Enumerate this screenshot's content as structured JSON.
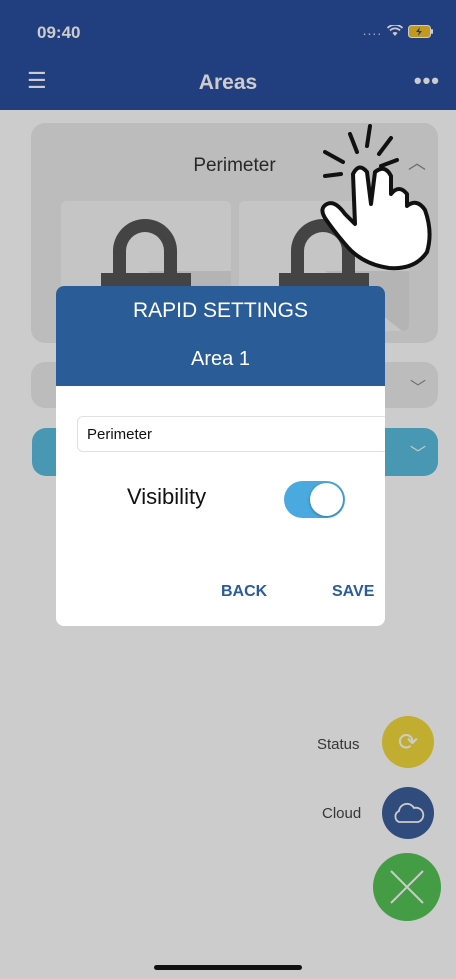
{
  "status_bar": {
    "time": "09:40",
    "signal": "....",
    "wifi_icon": "wifi-icon",
    "battery_icon": "battery-charging-icon"
  },
  "header": {
    "title": "Areas",
    "menu_icon": "hamburger-menu-icon",
    "more_icon": "more-dots-icon"
  },
  "area_card": {
    "title": "Perimeter",
    "chevron_icon": "chevron-up-icon"
  },
  "colors": {
    "header": "#2A4F9F",
    "dialog_header": "#2A5C97",
    "toggle_on": "#4aa9de",
    "status_fab": "#f2da3c",
    "cloud_fab": "#3d5f9c",
    "close_fab": "#55c455"
  },
  "dialog": {
    "title": "RAPID SETTINGS",
    "subtitle": "Area 1",
    "name_value": "Perimeter",
    "visibility_label": "Visibility",
    "visibility_on": true,
    "back_label": "BACK",
    "save_label": "SAVE"
  },
  "fabs": {
    "status_label": "Status",
    "cloud_label": "Cloud"
  }
}
